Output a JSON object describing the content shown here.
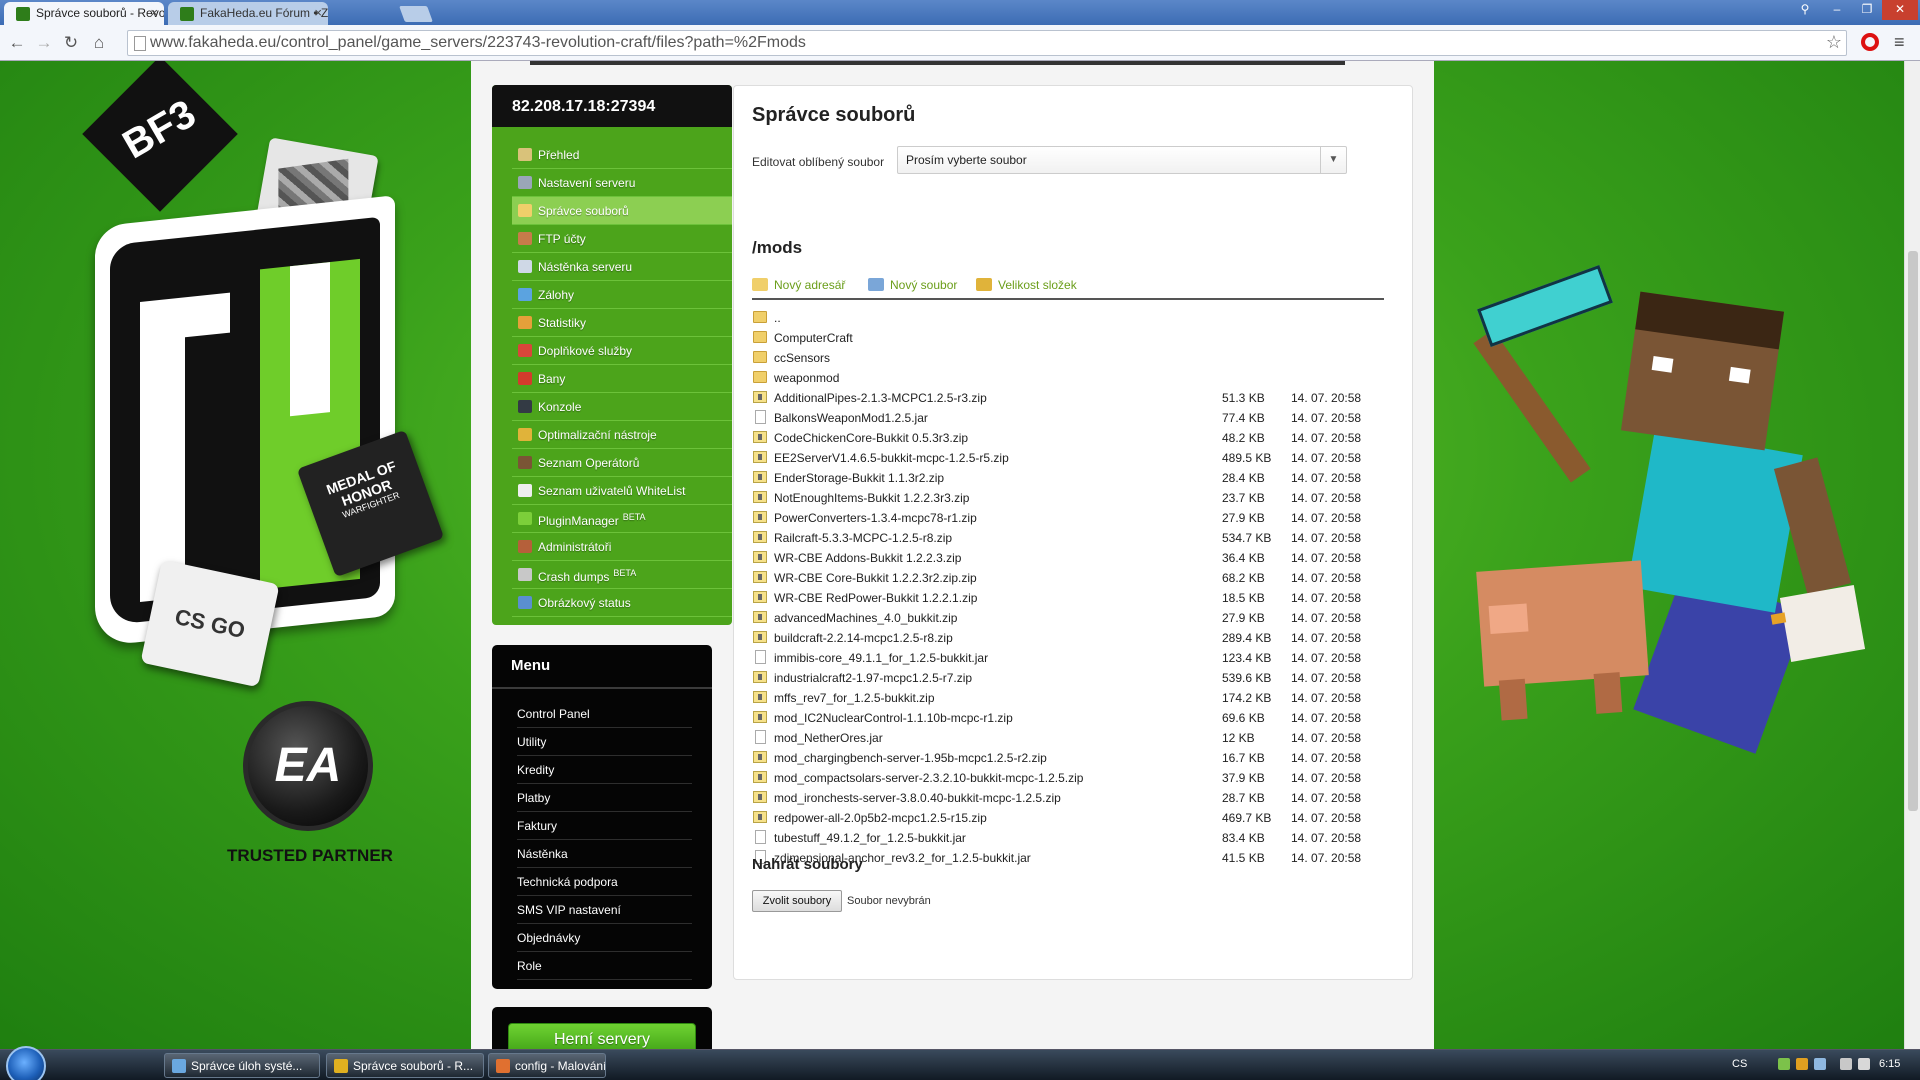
{
  "browser": {
    "tabs": [
      {
        "title": "Správce souborů - Revolut",
        "close": "×"
      },
      {
        "title": "FakaHeda.eu Fórum • Zob",
        "close": "×"
      }
    ],
    "url": "www.fakaheda.eu/control_panel/game_servers/223743-revolution-craft/files?path=%2Fmods"
  },
  "left_art": {
    "bf3": "BF3",
    "medal_line1": "MEDAL OF",
    "medal_line2": "HONOR",
    "medal_line3": "WARFIGHTER",
    "csgo": "CS GO",
    "ea": "EA",
    "trusted": "TRUSTED PARTNER"
  },
  "server": {
    "ip": "82.208.17.18:27394",
    "nav": [
      {
        "label": "Přehled",
        "icon": "overview-icon",
        "color": "#d9c27a"
      },
      {
        "label": "Nastavení serveru",
        "icon": "wrench-icon",
        "color": "#9aa6b8"
      },
      {
        "label": "Správce souborů",
        "icon": "folder-icon",
        "color": "#f0cf6a",
        "active": true
      },
      {
        "label": "FTP účty",
        "icon": "users-icon",
        "color": "#c77b4a"
      },
      {
        "label": "Nástěnka serveru",
        "icon": "board-icon",
        "color": "#cfd8e6"
      },
      {
        "label": "Zálohy",
        "icon": "backup-icon",
        "color": "#5ba3e0"
      },
      {
        "label": "Statistiky",
        "icon": "stats-icon",
        "color": "#e5a03a"
      },
      {
        "label": "Doplňkové služby",
        "icon": "gift-icon",
        "color": "#d9463a"
      },
      {
        "label": "Bany",
        "icon": "ban-icon",
        "color": "#d33b2c"
      },
      {
        "label": "Konzole",
        "icon": "console-icon",
        "color": "#333a44"
      },
      {
        "label": "Optimalizační nástroje",
        "icon": "tools-icon",
        "color": "#e0b33a"
      },
      {
        "label": "Seznam Operátorů",
        "icon": "operator-icon",
        "color": "#7a5535"
      },
      {
        "label": "Seznam uživatelů WhiteList",
        "icon": "whitelist-icon",
        "color": "#eeeeee"
      },
      {
        "label": "PluginManager",
        "badge": "BETA",
        "icon": "plugin-icon",
        "color": "#7ccf3a"
      },
      {
        "label": "Administrátoři",
        "icon": "admin-icon",
        "color": "#b5603a"
      },
      {
        "label": "Crash dumps",
        "badge": "BETA",
        "icon": "gear-icon",
        "color": "#c8c8c8"
      },
      {
        "label": "Obrázkový status",
        "icon": "image-icon",
        "color": "#5a8fd0"
      }
    ]
  },
  "menu": {
    "title": "Menu",
    "items": [
      "Control Panel",
      "Utility",
      "Kredity",
      "Platby",
      "Faktury",
      "Nástěnka",
      "Technická podpora",
      "SMS VIP nastavení",
      "Objednávky",
      "Role"
    ]
  },
  "herni": {
    "label": "Herní servery"
  },
  "main": {
    "title": "Správce souborů",
    "favorite_label": "Editovat oblíbený soubor",
    "favorite_value": "Prosím vyberte soubor",
    "path": "/mods",
    "actions": [
      {
        "label": "Nový adresář",
        "icon": "new-folder-icon",
        "color": "#f0cf6a"
      },
      {
        "label": "Nový soubor",
        "icon": "new-file-icon",
        "color": "#7aa6d8"
      },
      {
        "label": "Velikost složek",
        "icon": "folder-size-icon",
        "color": "#e0b33a"
      }
    ],
    "files": [
      {
        "type": "folder",
        "name": "..",
        "size": "",
        "date": ""
      },
      {
        "type": "folder",
        "name": "ComputerCraft",
        "size": "",
        "date": ""
      },
      {
        "type": "folder",
        "name": "ccSensors",
        "size": "",
        "date": ""
      },
      {
        "type": "folder",
        "name": "weaponmod",
        "size": "",
        "date": ""
      },
      {
        "type": "zip",
        "name": "AdditionalPipes-2.1.3-MCPC1.2.5-r3.zip",
        "size": "51.3 KB",
        "date": "14. 07. 20:58"
      },
      {
        "type": "file",
        "name": "BalkonsWeaponMod1.2.5.jar",
        "size": "77.4 KB",
        "date": "14. 07. 20:58"
      },
      {
        "type": "zip",
        "name": "CodeChickenCore-Bukkit 0.5.3r3.zip",
        "size": "48.2 KB",
        "date": "14. 07. 20:58"
      },
      {
        "type": "zip",
        "name": "EE2ServerV1.4.6.5-bukkit-mcpc-1.2.5-r5.zip",
        "size": "489.5 KB",
        "date": "14. 07. 20:58"
      },
      {
        "type": "zip",
        "name": "EnderStorage-Bukkit 1.1.3r2.zip",
        "size": "28.4 KB",
        "date": "14. 07. 20:58"
      },
      {
        "type": "zip",
        "name": "NotEnoughItems-Bukkit 1.2.2.3r3.zip",
        "size": "23.7 KB",
        "date": "14. 07. 20:58"
      },
      {
        "type": "zip",
        "name": "PowerConverters-1.3.4-mcpc78-r1.zip",
        "size": "27.9 KB",
        "date": "14. 07. 20:58"
      },
      {
        "type": "zip",
        "name": "Railcraft-5.3.3-MCPC-1.2.5-r8.zip",
        "size": "534.7 KB",
        "date": "14. 07. 20:58"
      },
      {
        "type": "zip",
        "name": "WR-CBE Addons-Bukkit 1.2.2.3.zip",
        "size": "36.4 KB",
        "date": "14. 07. 20:58"
      },
      {
        "type": "zip",
        "name": "WR-CBE Core-Bukkit 1.2.2.3r2.zip.zip",
        "size": "68.2 KB",
        "date": "14. 07. 20:58"
      },
      {
        "type": "zip",
        "name": "WR-CBE RedPower-Bukkit 1.2.2.1.zip",
        "size": "18.5 KB",
        "date": "14. 07. 20:58"
      },
      {
        "type": "zip",
        "name": "advancedMachines_4.0_bukkit.zip",
        "size": "27.9 KB",
        "date": "14. 07. 20:58"
      },
      {
        "type": "zip",
        "name": "buildcraft-2.2.14-mcpc1.2.5-r8.zip",
        "size": "289.4 KB",
        "date": "14. 07. 20:58"
      },
      {
        "type": "file",
        "name": "immibis-core_49.1.1_for_1.2.5-bukkit.jar",
        "size": "123.4 KB",
        "date": "14. 07. 20:58"
      },
      {
        "type": "zip",
        "name": "industrialcraft2-1.97-mcpc1.2.5-r7.zip",
        "size": "539.6 KB",
        "date": "14. 07. 20:58"
      },
      {
        "type": "zip",
        "name": "mffs_rev7_for_1.2.5-bukkit.zip",
        "size": "174.2 KB",
        "date": "14. 07. 20:58"
      },
      {
        "type": "zip",
        "name": "mod_IC2NuclearControl-1.1.10b-mcpc-r1.zip",
        "size": "69.6 KB",
        "date": "14. 07. 20:58"
      },
      {
        "type": "file",
        "name": "mod_NetherOres.jar",
        "size": "12 KB",
        "date": "14. 07. 20:58"
      },
      {
        "type": "zip",
        "name": "mod_chargingbench-server-1.95b-mcpc1.2.5-r2.zip",
        "size": "16.7 KB",
        "date": "14. 07. 20:58"
      },
      {
        "type": "zip",
        "name": "mod_compactsolars-server-2.3.2.10-bukkit-mcpc-1.2.5.zip",
        "size": "37.9 KB",
        "date": "14. 07. 20:58"
      },
      {
        "type": "zip",
        "name": "mod_ironchests-server-3.8.0.40-bukkit-mcpc-1.2.5.zip",
        "size": "28.7 KB",
        "date": "14. 07. 20:58"
      },
      {
        "type": "zip",
        "name": "redpower-all-2.0p5b2-mcpc1.2.5-r15.zip",
        "size": "469.7 KB",
        "date": "14. 07. 20:58"
      },
      {
        "type": "file",
        "name": "tubestuff_49.1.2_for_1.2.5-bukkit.jar",
        "size": "83.4 KB",
        "date": "14. 07. 20:58"
      },
      {
        "type": "file",
        "name": "zdimensional-anchor_rev3.2_for_1.2.5-bukkit.jar",
        "size": "41.5 KB",
        "date": "14. 07. 20:58"
      }
    ],
    "upload_title": "Nahrát soubory",
    "choose_label": "Zvolit soubory",
    "no_file": "Soubor nevybrán"
  },
  "taskbar": {
    "tasks": [
      {
        "label": "Správce úloh systé...",
        "icon": "task-manager-icon",
        "color": "#6aa8e0"
      },
      {
        "label": "Správce souborů - R...",
        "icon": "chrome-icon",
        "color": "#e0b020"
      },
      {
        "label": "config - Malování",
        "icon": "paint-icon",
        "color": "#e07030"
      }
    ],
    "lang": "CS",
    "clock": "6:15"
  }
}
